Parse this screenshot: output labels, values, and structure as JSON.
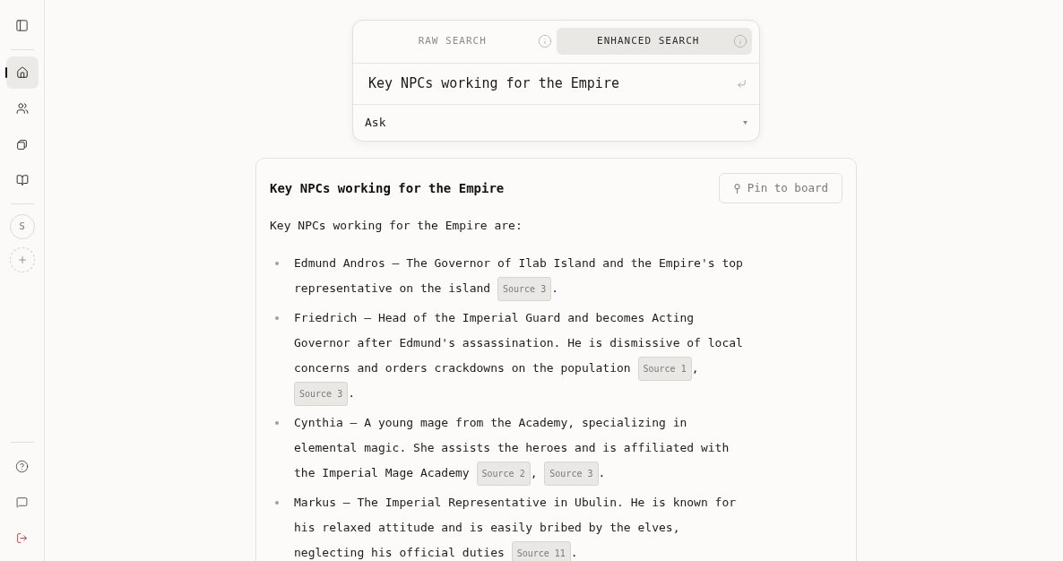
{
  "sidebar": {
    "nav_items": [
      {
        "selected": true
      },
      {
        "selected": false
      },
      {
        "selected": false
      },
      {
        "selected": false
      }
    ],
    "workspaces": [
      {
        "initial": "S"
      }
    ]
  },
  "search": {
    "tabs": [
      {
        "label": "RAW SEARCH",
        "selected": false
      },
      {
        "label": "ENHANCED SEARCH",
        "selected": true
      }
    ],
    "query": "Key NPCs working for the Empire",
    "mode": "Ask"
  },
  "answer": {
    "title": "Key NPCs working for the Empire",
    "pin_button": "Pin to board",
    "intro": "Key NPCs working for the Empire are:",
    "items": [
      {
        "segments": [
          {
            "kind": "text",
            "text": "Edmund Andros — The Governor of Ilab Island and the Empire's top representative on the island "
          },
          {
            "kind": "source",
            "text": "Source 3"
          },
          {
            "kind": "text",
            "text": "."
          }
        ]
      },
      {
        "segments": [
          {
            "kind": "text",
            "text": "Friedrich — Head of the Imperial Guard and becomes Acting Governor after Edmund's assassination. He is dismissive of local concerns and orders crackdowns on the population "
          },
          {
            "kind": "source",
            "text": "Source 1"
          },
          {
            "kind": "text",
            "text": ", "
          },
          {
            "kind": "source",
            "text": "Source 3"
          },
          {
            "kind": "text",
            "text": "."
          }
        ]
      },
      {
        "segments": [
          {
            "kind": "text",
            "text": "Cynthia — A young mage from the Academy, specializing in elemental magic. She assists the heroes and is affiliated with the Imperial Mage Academy "
          },
          {
            "kind": "source",
            "text": "Source 2"
          },
          {
            "kind": "text",
            "text": ", "
          },
          {
            "kind": "source",
            "text": "Source 3"
          },
          {
            "kind": "text",
            "text": "."
          }
        ]
      },
      {
        "segments": [
          {
            "kind": "text",
            "text": "Markus — The Imperial Representative in Ubulin. He is known for his relaxed attitude and is easily bribed by the elves, neglecting his official duties "
          },
          {
            "kind": "source",
            "text": "Source 11"
          },
          {
            "kind": "text",
            "text": "."
          }
        ]
      }
    ]
  }
}
